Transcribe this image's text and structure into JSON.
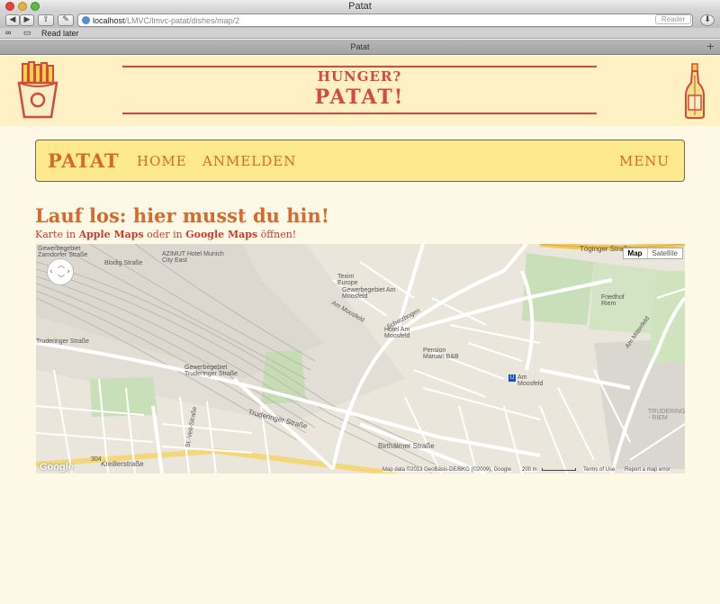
{
  "browser": {
    "window_title": "Patat",
    "url_host": "localhost",
    "url_path": "/LMVC/lmvc-patat/dishes/map/2",
    "reader_label": "Reader",
    "bookmark_read_later": "Read later",
    "tab_title": "Patat"
  },
  "header": {
    "subtitle": "HUNGER?",
    "title": "PATAT!"
  },
  "nav": {
    "brand": "PATAT",
    "home": "HOME",
    "login": "ANMELDEN",
    "menu": "MENU"
  },
  "content": {
    "heading": "Lauf los: hier musst du hin!",
    "links_prefix": "Karte in ",
    "apple_maps": "Apple Maps",
    "links_middle": " oder in ",
    "google_maps": "Google Maps",
    "links_suffix": " öffnen!"
  },
  "map": {
    "type_map": "Map",
    "type_satellite": "Satellite",
    "google_logo": "Google",
    "attribution": "Map data ©2013 GeoBasis-DE/BKG (©2009), Google",
    "scale": "200 m",
    "terms": "Terms of Use",
    "report": "Report a map error",
    "labels": {
      "toginger": "Töginger Straße",
      "azimut": "AZIMUT Hotel Munich City East",
      "gewerbe1": "Gewerbegebiet Zamdorfer Straße",
      "blodig": "Blodig Straße",
      "texim": "Texim Europe",
      "gewerbe2": "Gewerbegebiet Am Moosfeld",
      "schatzbogen": "Schatzbogen",
      "hotel": "Hotel Am Moosfeld",
      "pension": "Pension Maruan B&B",
      "friedhof": "Friedhof Riem",
      "truderinger": "Truderinger Straße",
      "gewerbe3": "Gewerbegebiet Truderinger Straße",
      "birthalmer": "Birthälmer Straße",
      "am_moosfeld": "Am Moosfeld",
      "am_mitterfeld": "Am Mitterfeld",
      "kreiller": "Kreillerstraße",
      "st_veit": "St.-Veit-Straße",
      "truderinger_str2": "Truderinger Straße",
      "trudering": "TRUDERING - RIEM",
      "am_moosfeld_station": "Am Moosfeld",
      "road_304": "304"
    }
  }
}
